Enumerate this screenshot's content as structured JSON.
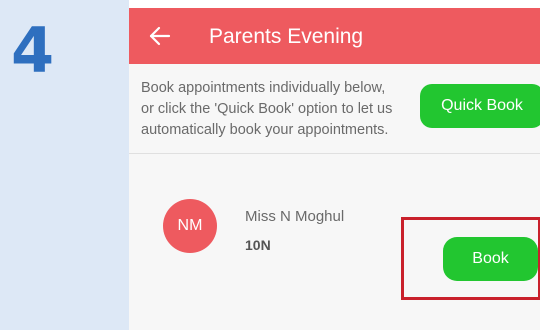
{
  "tutorial": {
    "step_number": "4"
  },
  "appbar": {
    "title": "Parents Evening",
    "back_icon": "arrow-left-icon"
  },
  "intro": {
    "lines": [
      "Book appointments individually below,",
      "or click the 'Quick Book' option to let us",
      "automatically book your appointments."
    ],
    "quick_book_label": "Quick Book"
  },
  "appointment": {
    "initials": "NM",
    "teacher_name": "Miss N Moghul",
    "class_code": "10N",
    "book_label": "Book"
  },
  "colors": {
    "appbar": "#ee5a5f",
    "button_green": "#22c630",
    "highlight_red": "#c9202b",
    "step_number": "#2e6fbf",
    "page_background": "#dde8f6"
  }
}
